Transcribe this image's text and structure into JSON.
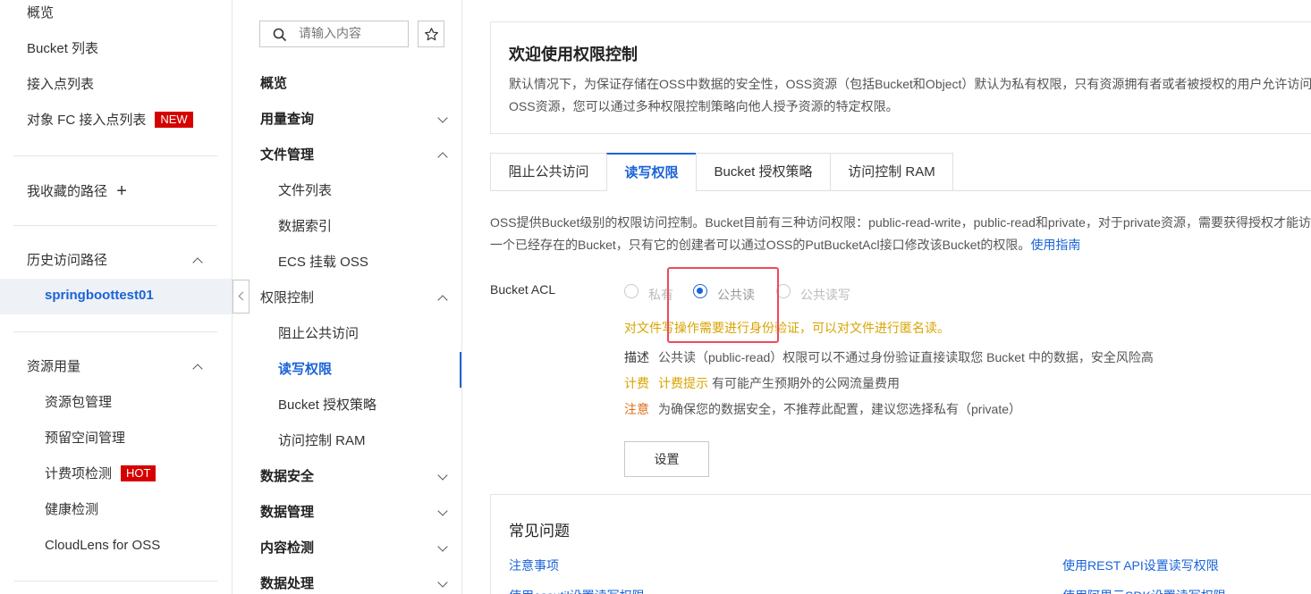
{
  "left_nav": {
    "overview": "概览",
    "bucket_list": "Bucket 列表",
    "access_points": "接入点列表",
    "fc_access_points": "对象 FC 接入点列表",
    "new_badge": "NEW",
    "favorites": "我收藏的路径",
    "history": "历史访问路径",
    "active_bucket": "springboottest01",
    "resource_usage": "资源用量",
    "resource_pkg": "资源包管理",
    "reserved_space": "预留空间管理",
    "billing_check": "计费项检测",
    "hot_badge": "HOT",
    "health_check": "健康检测",
    "cloudlens": "CloudLens for OSS"
  },
  "sec_nav": {
    "search_placeholder": "请输入内容",
    "overview": "概览",
    "usage": "用量查询",
    "file_mgmt": "文件管理",
    "file_list": "文件列表",
    "data_index": "数据索引",
    "ecs_mount": "ECS 挂载 OSS",
    "perm_control": "权限控制",
    "block_public": "阻止公共访问",
    "rw_perm": "读写权限",
    "bucket_policy": "Bucket 授权策略",
    "ram": "访问控制 RAM",
    "data_security": "数据安全",
    "data_mgmt": "数据管理",
    "content_detect": "内容检测",
    "data_processing": "数据处理"
  },
  "welcome": {
    "title": "欢迎使用权限控制",
    "line1": "默认情况下，为保证存储在OSS中数据的安全性，OSS资源（包括Bucket和Object）默认为私有权限，只有资源拥有者或者被授权的用户允许访问",
    "line2": "OSS资源，您可以通过多种权限控制策略向他人授予资源的特定权限。"
  },
  "tabs": [
    "阻止公共访问",
    "读写权限",
    "Bucket 授权策略",
    "访问控制 RAM"
  ],
  "info": {
    "line1": "OSS提供Bucket级别的权限访问控制。Bucket目前有三种访问权限：public-read-write，public-read和private，对于private资源，需要获得授权才能访问。对于",
    "line2": "一个已经存在的Bucket，只有它的创建者可以通过OSS的PutBucketAcl接口修改该Bucket的权限。",
    "guide_link": "使用指南"
  },
  "acl": {
    "label": "Bucket ACL",
    "options": [
      "私有",
      "公共读",
      "公共读写"
    ],
    "selected": "公共读",
    "warning": "对文件写操作需要进行身份验证，可以对文件进行匿名读。",
    "desc_label": "描述",
    "desc_text": "公共读（public-read）权限可以不通过身份验证直接读取您 Bucket 中的数据，安全风险高",
    "billing_label": "计费",
    "billing_link": "计费提示",
    "billing_text": "有可能产生预期外的公网流量费用",
    "note_label": "注意",
    "note_text": "为确保您的数据安全，不推荐此配置，建议您选择私有（private）",
    "set_button": "设置"
  },
  "faq": {
    "title": "常见问题",
    "items": [
      "注意事项",
      "使用REST API设置读写权限",
      "使用ossutil设置读写权限",
      "使用阿里云SDK设置读写权限"
    ]
  },
  "colors": {
    "accent": "#1a63d8",
    "badge_red": "#d50000",
    "warning_text": "#d9a300",
    "note_text": "#e06c1a",
    "highlight_box": "#f0485f"
  }
}
